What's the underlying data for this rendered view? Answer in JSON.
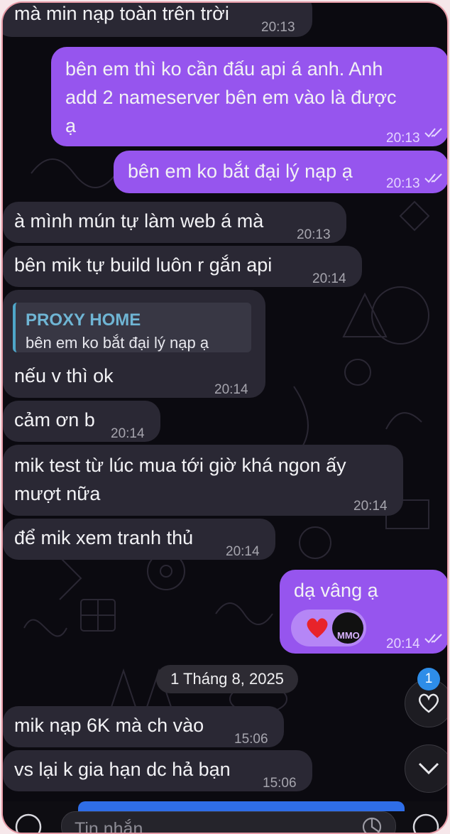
{
  "messages": {
    "m0": {
      "text": "mà min nạp toàn trên trời",
      "time": "20:13"
    },
    "m1": {
      "line1": "bên em thì ko cần đấu api á anh. Anh",
      "line2": "add 2 nameserver bên em vào là được",
      "line3": "ạ",
      "time": "20:13"
    },
    "m2": {
      "text": "bên em ko bắt đại lý nạp ạ",
      "time": "20:13"
    },
    "m3": {
      "text": "à mình mún tự làm web á mà",
      "time": "20:13"
    },
    "m4": {
      "text": "bên mik tự build luôn r gắn api",
      "time": "20:14"
    },
    "m5": {
      "reply_name": "PROXY HOME",
      "reply_text": "bên em ko bắt đại lý nạp ạ",
      "text": "nếu v thì ok",
      "time": "20:14"
    },
    "m6": {
      "text": "cảm ơn b",
      "time": "20:14"
    },
    "m7": {
      "line1": "mik test từ lúc mua tới giờ khá ngon ấy",
      "line2": "mượt nữa",
      "time": "20:14"
    },
    "m8": {
      "text": "để mik xem tranh thủ",
      "time": "20:14"
    },
    "m9": {
      "text": "dạ vâng ạ",
      "time": "20:14",
      "reaction_logo": "MMO"
    },
    "m10": {
      "text": "mik nạp 6K mà ch vào",
      "time": "15:06"
    },
    "m11": {
      "text": "vs lại k gia hạn dc hả bạn",
      "time": "15:06"
    }
  },
  "date_separator": "1 Tháng 8, 2025",
  "reaction_badge_count": "1",
  "composer": {
    "placeholder": "Tin nhắn"
  },
  "colors": {
    "outgoing": "#9655ee",
    "incoming": "#2a2834",
    "accent": "#2e8de8",
    "frame": "#e59aa6"
  },
  "icons": [
    "heart-icon",
    "chevron-down-icon",
    "double-check-icon",
    "sticker-icon",
    "attach-icon"
  ]
}
